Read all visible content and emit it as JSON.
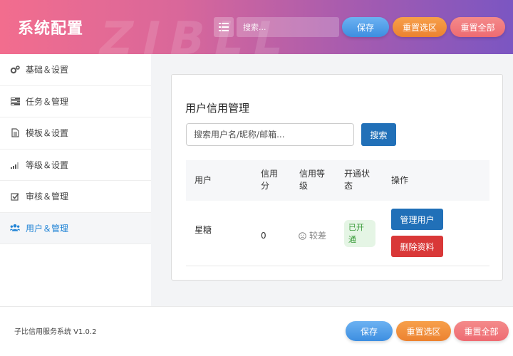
{
  "header": {
    "title": "系统配置",
    "watermark": "ZIBLL",
    "search_placeholder": "搜索...",
    "save_label": "保存",
    "reset_selection_label": "重置选区",
    "reset_all_label": "重置全部"
  },
  "sidebar": {
    "items": [
      {
        "label": "基础＆设置",
        "icon": "gears-icon",
        "active": false
      },
      {
        "label": "任务＆管理",
        "icon": "tasks-icon",
        "active": false
      },
      {
        "label": "模板＆设置",
        "icon": "file-icon",
        "active": false
      },
      {
        "label": "等级＆设置",
        "icon": "signal-icon",
        "active": false
      },
      {
        "label": "审核＆管理",
        "icon": "check-square-icon",
        "active": false
      },
      {
        "label": "用户＆管理",
        "icon": "users-icon",
        "active": true
      }
    ]
  },
  "main": {
    "title": "用户信用管理",
    "search_placeholder": "搜索用户名/昵称/邮箱...",
    "search_button": "搜索",
    "table": {
      "headers": {
        "user": "用户",
        "score_l1": "信用",
        "score_l2": "分",
        "grade_l1": "信用等",
        "grade_l2": "级",
        "status_l1": "开通状",
        "status_l2": "态",
        "action": "操作"
      },
      "rows": [
        {
          "user": "星糖",
          "score": "0",
          "grade": "较差",
          "status_l1": "已开",
          "status_l2": "通",
          "manage_label": "管理用户",
          "delete_label": "删除资料"
        }
      ]
    }
  },
  "footer": {
    "version": "子比信用服务系统 V1.0.2",
    "save_label": "保存",
    "reset_selection_label": "重置选区",
    "reset_all_label": "重置全部"
  },
  "colors": {
    "primary_blue": "#2170b8",
    "danger_red": "#d93838",
    "active_nav": "#2385d6",
    "success_green": "#3a9c3a"
  }
}
